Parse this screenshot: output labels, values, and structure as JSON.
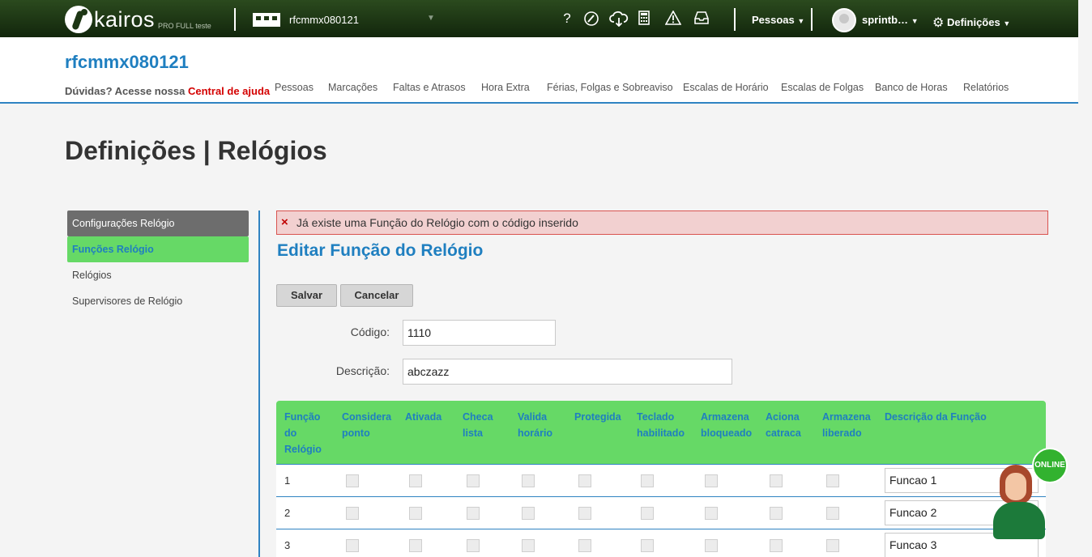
{
  "topbar": {
    "logo_text": "kairos",
    "logo_sub": "PRO FULL teste",
    "company": "rfcmmx080121",
    "icons": [
      "help-icon",
      "rocket-icon",
      "cloud-download-icon",
      "calculator-icon",
      "warning-icon",
      "inbox-icon"
    ],
    "people_menu": "Pessoas",
    "user_name": "sprintb…",
    "settings_menu": "Definições"
  },
  "header": {
    "client_title": "rfcmmx080121",
    "help_prefix": "Dúvidas? Acesse nossa",
    "help_link": "Central de ajuda",
    "nav": [
      "Pessoas",
      "Marcações",
      "Faltas e Atrasos",
      "Hora Extra",
      "Férias, Folgas e Sobreaviso",
      "Escalas de Horário",
      "Escalas de Folgas",
      "Banco de Horas",
      "Relatórios"
    ]
  },
  "page_title": "Definições | Relógios",
  "sidebar": {
    "items": [
      "Configurações Relógio",
      "Funções Relógio",
      "Relógios",
      "Supervisores de Relógio"
    ]
  },
  "main": {
    "alert": "Já existe uma Função do Relógio com o código inserido",
    "form_title": "Editar Função do Relógio",
    "save_label": "Salvar",
    "cancel_label": "Cancelar",
    "code_label": "Código:",
    "code_value": "1110",
    "desc_label": "Descrição:",
    "desc_value": "abczazz"
  },
  "table": {
    "headers": [
      [
        "Função",
        "do",
        "Relógio"
      ],
      [
        "Considera",
        "ponto"
      ],
      [
        "Ativada"
      ],
      [
        "Checa",
        "lista"
      ],
      [
        "Valida",
        "horário"
      ],
      [
        "Protegida"
      ],
      [
        "Teclado",
        "habilitado"
      ],
      [
        "Armazena",
        "bloqueado"
      ],
      [
        "Aciona",
        "catraca"
      ],
      [
        "Armazena",
        "liberado"
      ],
      [
        "Descrição da Função"
      ]
    ],
    "rows": [
      {
        "num": "1",
        "desc": "Funcao 1"
      },
      {
        "num": "2",
        "desc": "Funcao 2"
      },
      {
        "num": "3",
        "desc": "Funcao 3"
      }
    ]
  },
  "chat": {
    "badge": "ONLINE"
  },
  "colors": {
    "topbar": "#1d3614",
    "accent_blue": "#1f7fc0",
    "highlight_green": "#66d966",
    "alert_red": "#d40000"
  }
}
